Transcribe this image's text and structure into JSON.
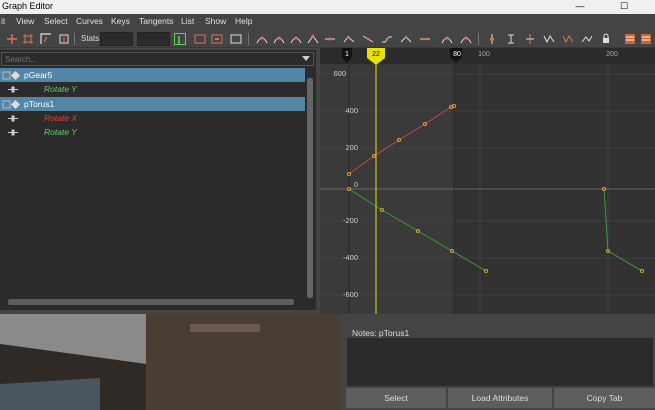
{
  "window": {
    "title": "Graph Editor"
  },
  "menu": [
    "it",
    "View",
    "Select",
    "Curves",
    "Keys",
    "Tangents",
    "List",
    "Show",
    "Help"
  ],
  "toolbar": {
    "stats_label": "Stats"
  },
  "outliner": {
    "search_placeholder": "Search...",
    "items": [
      {
        "label": "pGear5",
        "type": "object",
        "selected": true
      },
      {
        "label": "Rotate Y",
        "type": "channel",
        "color": "#5fd15f"
      },
      {
        "label": "pTorus1",
        "type": "object",
        "selected": true
      },
      {
        "label": "Rotate X",
        "type": "channel",
        "color": "#e04040"
      },
      {
        "label": "Rotate Y",
        "type": "channel",
        "color": "#5fd15f"
      }
    ]
  },
  "graph": {
    "time_labels": [
      "1",
      "22",
      "80",
      "100",
      "200"
    ],
    "current_frame": "22",
    "value_labels": [
      "600",
      "400",
      "200",
      "0",
      "-200",
      "-400",
      "-600"
    ]
  },
  "colors": {
    "red_curve": "#c04848",
    "green_curve": "#3d9a3d",
    "key_point": "#e0a030",
    "current_time": "#e8e000",
    "selection": "#5285a6"
  },
  "notes": {
    "label": "Notes:  pTorus1",
    "buttons": [
      "Select",
      "Load Attributes",
      "Copy Tab"
    ]
  }
}
